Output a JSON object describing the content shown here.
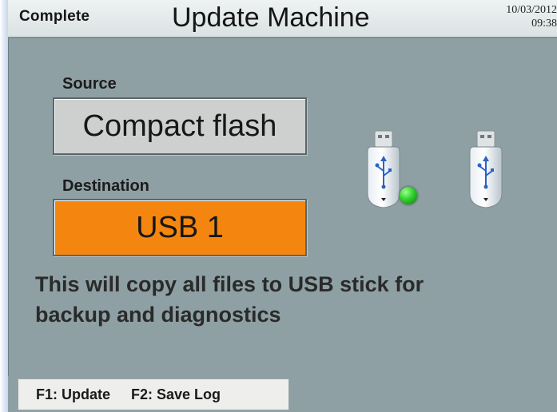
{
  "header": {
    "status": "Complete",
    "title": "Update Machine",
    "date": "10/03/2012",
    "time": "09:38"
  },
  "source": {
    "label": "Source",
    "value": "Compact flash",
    "color": "#cdd0cf"
  },
  "destination": {
    "label": "Destination",
    "value": "USB 1",
    "color": "#f4860f"
  },
  "usb_devices": [
    {
      "icon": "usb-stick-icon",
      "indicator": "active"
    },
    {
      "icon": "usb-stick-icon",
      "indicator": "none"
    }
  ],
  "message": {
    "line1": "This will copy all files to USB stick for",
    "line2": "backup and diagnostics"
  },
  "footer": {
    "f1": "F1: Update",
    "f2": "F2: Save Log"
  },
  "colors": {
    "screen_bg": "#8ea0a4",
    "indicator_green": "#2fd12b"
  }
}
